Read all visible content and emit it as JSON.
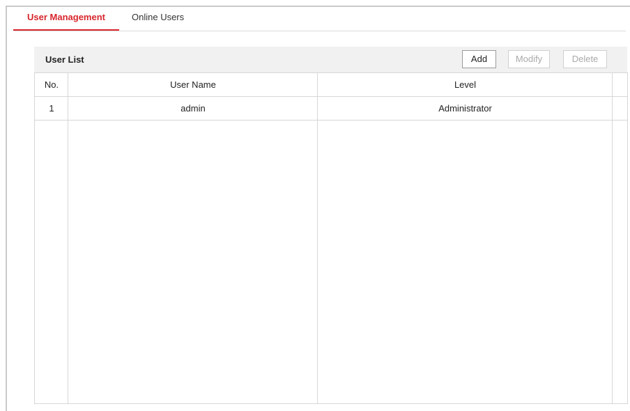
{
  "tabs": {
    "user_management": "User Management",
    "online_users": "Online Users"
  },
  "panel": {
    "title": "User List",
    "buttons": {
      "add": "Add",
      "modify": "Modify",
      "delete": "Delete"
    }
  },
  "table": {
    "columns": {
      "no": "No.",
      "user_name": "User Name",
      "level": "Level"
    },
    "rows": [
      {
        "no": "1",
        "user_name": "admin",
        "level": "Administrator"
      }
    ]
  },
  "colors": {
    "accent": "#d7262c",
    "header_bg": "#f1f1f1",
    "border": "#d6d6d6",
    "disabled_text": "#aaaaaa"
  }
}
